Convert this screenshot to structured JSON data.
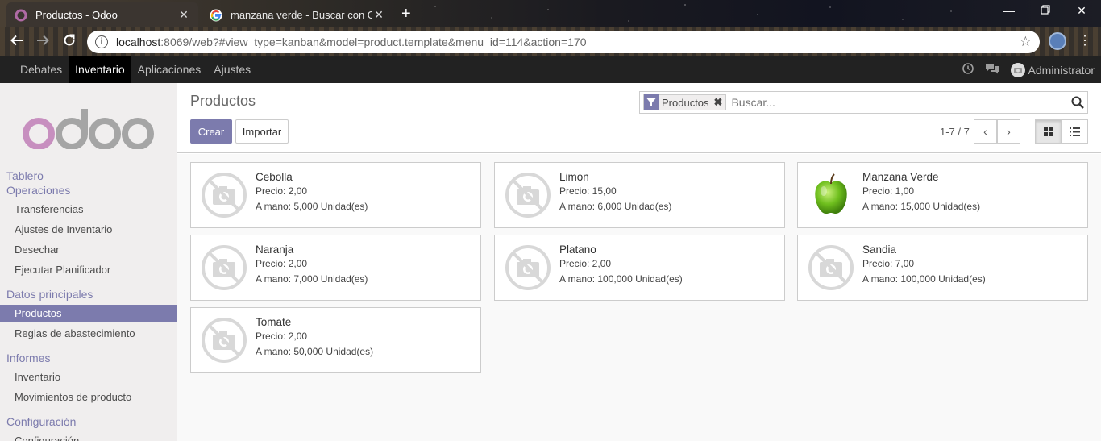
{
  "browser": {
    "tabs": [
      {
        "title": "Productos - Odoo",
        "active": true,
        "icon": "odoo-favicon"
      },
      {
        "title": "manzana verde - Buscar con Google",
        "active": false,
        "icon": "google-favicon"
      }
    ],
    "url_host": "localhost",
    "url_rest": ":8069/web?#view_type=kanban&model=product.template&menu_id=114&action=170"
  },
  "mainnav": {
    "menu": [
      "Debates",
      "Inventario",
      "Aplicaciones",
      "Ajustes"
    ],
    "active": "Inventario",
    "user": "Administrator"
  },
  "sidebar": {
    "brand": "odoo",
    "sections": [
      {
        "label": "Tablero",
        "items": []
      },
      {
        "label": "Operaciones",
        "items": [
          "Transferencias",
          "Ajustes de Inventario",
          "Desechar",
          "Ejecutar Planificador"
        ]
      },
      {
        "label": "Datos principales",
        "items": [
          "Productos",
          "Reglas de abastecimiento"
        ]
      },
      {
        "label": "Informes",
        "items": [
          "Inventario",
          "Movimientos de producto"
        ]
      },
      {
        "label": "Configuración",
        "items": [
          "Configuración"
        ]
      }
    ],
    "active_item": "Productos"
  },
  "cpanel": {
    "title": "Productos",
    "create_label": "Crear",
    "import_label": "Importar",
    "facet_label": "Productos",
    "search_placeholder": "Buscar...",
    "pager": "1-7 / 7",
    "view_active": "kanban"
  },
  "products": [
    {
      "name": "Cebolla",
      "price": "Precio: 2,00",
      "qty": "A mano: 5,000 Unidad(es)",
      "image": "placeholder"
    },
    {
      "name": "Limon",
      "price": "Precio: 15,00",
      "qty": "A mano: 6,000 Unidad(es)",
      "image": "placeholder"
    },
    {
      "name": "Manzana Verde",
      "price": "Precio: 1,00",
      "qty": "A mano: 15,000 Unidad(es)",
      "image": "green-apple"
    },
    {
      "name": "Naranja",
      "price": "Precio: 2,00",
      "qty": "A mano: 7,000 Unidad(es)",
      "image": "placeholder"
    },
    {
      "name": "Platano",
      "price": "Precio: 2,00",
      "qty": "A mano: 100,000 Unidad(es)",
      "image": "placeholder"
    },
    {
      "name": "Sandia",
      "price": "Precio: 7,00",
      "qty": "A mano: 100,000 Unidad(es)",
      "image": "placeholder"
    },
    {
      "name": "Tomate",
      "price": "Precio: 2,00",
      "qty": "A mano: 50,000 Unidad(es)",
      "image": "placeholder"
    }
  ],
  "colors": {
    "brand": "#7c7bad",
    "navbar": "#222222"
  }
}
